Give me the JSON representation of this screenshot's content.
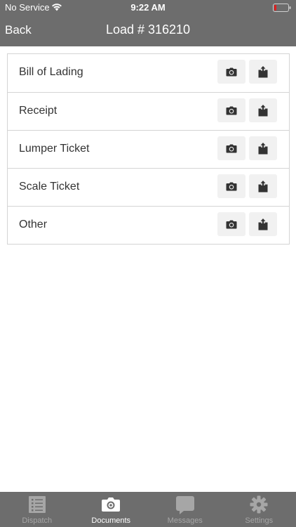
{
  "status_bar": {
    "carrier": "No Service",
    "time": "9:22 AM",
    "battery_color": "#e02020"
  },
  "nav": {
    "back_label": "Back",
    "title": "Load # 316210"
  },
  "documents": [
    {
      "label": "Bill of Lading",
      "camera_icon": "camera-icon",
      "upload_icon": "upload-icon"
    },
    {
      "label": "Receipt",
      "camera_icon": "camera-icon",
      "upload_icon": "upload-icon"
    },
    {
      "label": "Lumper Ticket",
      "camera_icon": "camera-icon",
      "upload_icon": "upload-icon"
    },
    {
      "label": "Scale Ticket",
      "camera_icon": "camera-icon",
      "upload_icon": "upload-icon"
    },
    {
      "label": "Other",
      "camera_icon": "camera-icon",
      "upload_icon": "upload-icon"
    }
  ],
  "tabs": [
    {
      "label": "Dispatch",
      "icon": "list-icon",
      "active": false
    },
    {
      "label": "Documents",
      "icon": "camera-icon",
      "active": true
    },
    {
      "label": "Messages",
      "icon": "chat-bubble-icon",
      "active": false
    },
    {
      "label": "Settings",
      "icon": "gear-icon",
      "active": false
    }
  ],
  "colors": {
    "header_bg": "#6d6d6d",
    "tab_bar_bg": "#6d6d6d",
    "inactive_tab": "#a6a6a6",
    "active_tab": "#ffffff",
    "row_border": "#d4d4d4",
    "button_bg": "#f1f1f1"
  }
}
